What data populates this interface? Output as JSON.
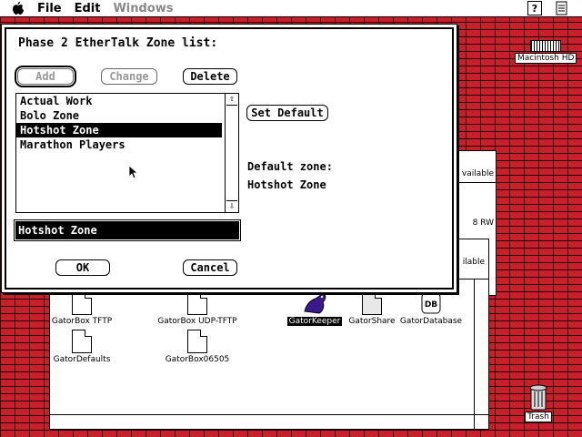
{
  "menubar": {
    "items": [
      "File",
      "Edit",
      "Windows"
    ],
    "help_icon": "?",
    "app_icon": "document-icon"
  },
  "desktop": {
    "disk_label": "Macintosh HD",
    "trash_label": "Trash"
  },
  "finder": {
    "icons": [
      {
        "label": "GatorBox TFTP"
      },
      {
        "label": "GatorBox UDP-TFTP"
      },
      {
        "label": "GatorKeeper"
      },
      {
        "label": "GatorShare"
      },
      {
        "label": "GatorDatabase"
      },
      {
        "label": "GatorDefaults"
      },
      {
        "label": "GatorBox06505"
      }
    ],
    "partial_texts": [
      "vailable",
      "8 RW",
      "ilable"
    ]
  },
  "dialog": {
    "title": "Phase 2 EtherTalk Zone list:",
    "buttons": {
      "add": "Add",
      "change": "Change",
      "delete": "Delete",
      "set_default": "Set Default",
      "ok": "OK",
      "cancel": "Cancel"
    },
    "zones": [
      "Actual Work",
      "Bolo Zone",
      "Hotshot Zone",
      "Marathon Players"
    ],
    "selected_zone": "Hotshot Zone",
    "field_value": "Hotshot Zone",
    "default_zone_label": "Default zone:",
    "default_zone_value": "Hotshot Zone"
  }
}
